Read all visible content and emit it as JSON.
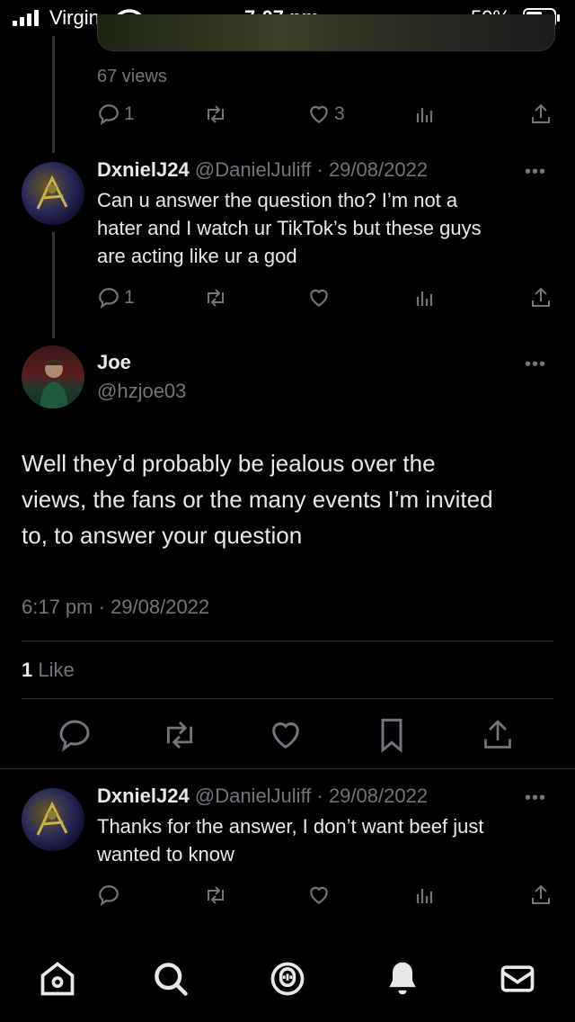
{
  "status_bar": {
    "carrier": "Virgin",
    "time": "7:07 pm",
    "battery": "59%",
    "battery_level": 0.59
  },
  "top_tweet": {
    "views": "67 views",
    "replies": "1",
    "likes": "3"
  },
  "reply1": {
    "display_name": "DxnielJ24",
    "handle_date": "@DanielJuliff · 29/08/2022",
    "text_lines": [
      "Can u answer the question tho? I’m not a",
      "hater and I watch ur TikTok’s but these guys",
      "are acting like ur a god"
    ],
    "replies": "1"
  },
  "main_tweet": {
    "display_name": "Joe",
    "handle": "@hzjoe03",
    "text_lines": [
      "Well they’d probably be jealous over the",
      "views, the fans or the many events I’m invited",
      "to, to answer your question"
    ],
    "timestamp": "6:17 pm · 29/08/2022",
    "likes_count": "1",
    "likes_label": "Like"
  },
  "reply2": {
    "display_name": "DxnielJ24",
    "handle_date": "@DanielJuliff · 29/08/2022",
    "text_lines": [
      "Thanks for the answer, I don’t want beef just",
      "wanted to know"
    ]
  },
  "more_glyph": "•••",
  "icons": {
    "reply": "reply-icon",
    "retweet": "retweet-icon",
    "like": "heart-icon",
    "views": "analytics-icon",
    "share": "share-icon",
    "bookmark": "bookmark-icon",
    "home": "home-icon",
    "search": "search-icon",
    "spaces": "spaces-icon",
    "notifications": "bell-icon",
    "messages": "mail-icon"
  },
  "colors": {
    "background": "#000000",
    "text": "#e7e9ea",
    "muted": "#71767b",
    "divider": "#2f3336"
  }
}
